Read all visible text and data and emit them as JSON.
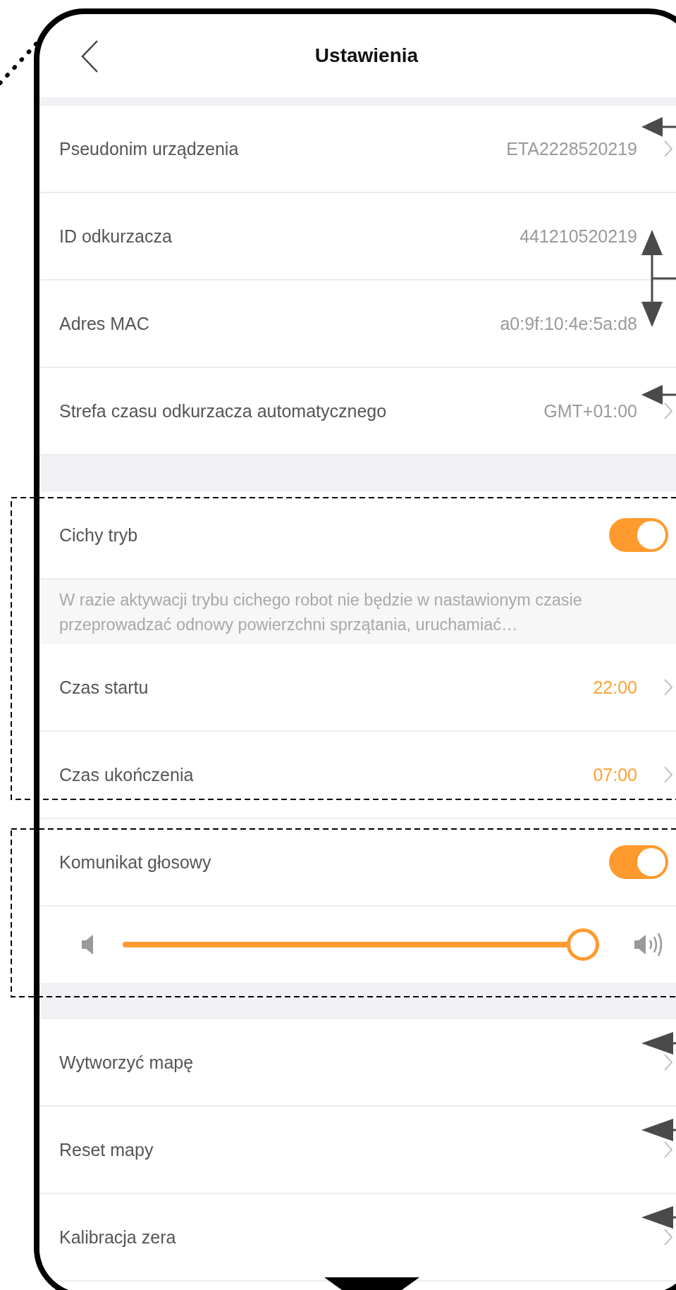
{
  "header": {
    "title": "Ustawienia"
  },
  "groups": [
    {
      "rows": [
        {
          "kind": "value",
          "label": "Pseudonim urządzenia",
          "value": "ETA2228520219",
          "chevron": true
        },
        {
          "kind": "value",
          "label": "ID odkurzacza",
          "value": "441210520219",
          "chevron": false
        },
        {
          "kind": "value",
          "label": "Adres MAC",
          "value": "a0:9f:10:4e:5a:d8",
          "chevron": false
        },
        {
          "kind": "value",
          "label": "Strefa czasu odkurzacza automatycznego",
          "value": "GMT+01:00",
          "chevron": true
        }
      ]
    },
    {
      "rows": [
        {
          "kind": "toggle",
          "label": "Cichy tryb",
          "on": true
        },
        {
          "kind": "note",
          "text": "W razie aktywacji trybu cichego robot nie będzie w nastawionym czasie przeprowadzać odnowy powierzchni sprzątania, uruchamiać…"
        },
        {
          "kind": "time",
          "label": "Czas startu",
          "value": "22:00",
          "chevron": true
        },
        {
          "kind": "time",
          "label": "Czas ukończenia",
          "value": "07:00",
          "chevron": true
        },
        {
          "kind": "toggle",
          "label": "Komunikat głosowy",
          "on": true
        },
        {
          "kind": "slider",
          "level": 1
        }
      ]
    },
    {
      "rows": [
        {
          "kind": "link",
          "label": "Wytworzyć mapę"
        },
        {
          "kind": "link",
          "label": "Reset mapy"
        },
        {
          "kind": "link",
          "label": "Kalibracja zera"
        }
      ]
    }
  ]
}
